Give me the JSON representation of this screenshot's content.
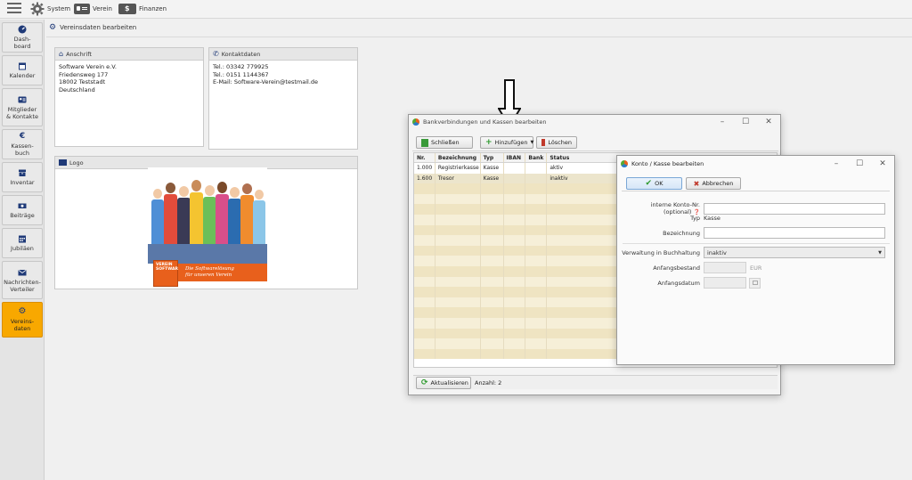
{
  "topbar": {
    "system_label": "System",
    "verein_label": "Verein",
    "finanzen_label": "Finanzen"
  },
  "sidebar": {
    "items": [
      {
        "label": "Dash-\nboard",
        "icon": "dashboard-icon"
      },
      {
        "label": "Kalender",
        "icon": "calendar-icon"
      },
      {
        "label": "Mitglieder\n& Kontakte",
        "icon": "members-icon"
      },
      {
        "label": "Kassen-\nbuch",
        "icon": "euro-icon"
      },
      {
        "label": "Inventar",
        "icon": "inventory-icon"
      },
      {
        "label": "Beiträge",
        "icon": "money-icon"
      },
      {
        "label": "Jubiläen",
        "icon": "calendar-grid-icon"
      },
      {
        "label": "Nachrichten-\nVerteiler",
        "icon": "mail-icon"
      },
      {
        "label": "Vereins-\ndaten",
        "icon": "gear-icon"
      }
    ]
  },
  "main": {
    "title": "Vereinsdaten bearbeiten",
    "anschrift": {
      "title": "Anschrift",
      "lines": [
        "Software Verein  e.V.",
        "Friedensweg 177",
        "18002 Teststadt",
        "Deutschland"
      ]
    },
    "kontakt": {
      "title": "Kontaktdaten",
      "lines": [
        "Tel.: 03342 779925",
        "Tel.: 0151 1144367",
        "E-Mail: Software-Verein@testmail.de"
      ]
    },
    "logo": {
      "title": "Logo",
      "banner_line1": "Die Softwarelösung",
      "banner_line2": "für unseren Verein",
      "box_text": "VEREIN\nSOFTWARE"
    }
  },
  "bank_dialog": {
    "title": "Bankverbindungen und Kassen bearbeiten",
    "buttons": {
      "close": "Schließen",
      "add": "Hinzufügen",
      "delete": "Löschen",
      "refresh": "Aktualisieren"
    },
    "columns": [
      "Nr.",
      "Bezeichnung",
      "Typ",
      "IBAN",
      "Bank",
      "Status"
    ],
    "rows": [
      {
        "nr": "1.000",
        "bez": "Registrierkasse",
        "typ": "Kasse",
        "iban": "",
        "bank": "",
        "status": "aktiv"
      },
      {
        "nr": "1.600",
        "bez": "Tresor",
        "typ": "Kasse",
        "iban": "",
        "bank": "",
        "status": "inaktiv"
      }
    ],
    "count_text": "Anzahl: 2"
  },
  "edit_dialog": {
    "title": "Konto / Kasse bearbeiten",
    "ok": "OK",
    "cancel": "Abbrechen",
    "fields": {
      "konto_label": "interne Konto-Nr. (optional)",
      "typ_label": "Typ",
      "typ_value": "Kasse",
      "bez_label": "Bezeichnung",
      "verwaltung_label": "Verwaltung in Buchhaltung",
      "verwaltung_value": "inaktiv",
      "bestand_label": "Anfangsbestand",
      "bestand_unit": "EUR",
      "datum_label": "Anfangsdatum"
    }
  },
  "colors": {
    "accent": "#f8a800",
    "grid_alt": "#efe4c2",
    "banner": "#e8601c"
  }
}
